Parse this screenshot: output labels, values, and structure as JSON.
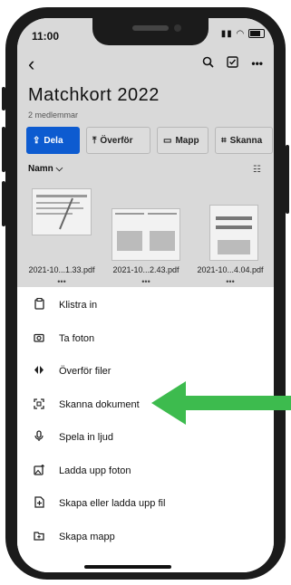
{
  "status": {
    "time": "11:00"
  },
  "folder": {
    "title": "Matchkort 2022",
    "members": "2 medlemmar"
  },
  "actions": [
    {
      "label": "Dela",
      "icon": "share-icon"
    },
    {
      "label": "Överför",
      "icon": "upload-icon"
    },
    {
      "label": "Mapp",
      "icon": "folder-icon"
    },
    {
      "label": "Skanna",
      "icon": "scan-icon"
    }
  ],
  "sort": {
    "label": "Namn"
  },
  "files": [
    {
      "name": "2021-10...1.33.pdf"
    },
    {
      "name": "2021-10...2.43.pdf"
    },
    {
      "name": "2021-10...4.04.pdf"
    }
  ],
  "menu": [
    {
      "label": "Klistra in",
      "icon": "paste-icon"
    },
    {
      "label": "Ta foton",
      "icon": "camera-icon"
    },
    {
      "label": "Överför filer",
      "icon": "transfer-icon"
    },
    {
      "label": "Skanna dokument",
      "icon": "scan-document-icon"
    },
    {
      "label": "Spela in ljud",
      "icon": "microphone-icon"
    },
    {
      "label": "Ladda upp foton",
      "icon": "upload-photo-icon"
    },
    {
      "label": "Skapa eller ladda upp fil",
      "icon": "create-file-icon"
    },
    {
      "label": "Skapa mapp",
      "icon": "create-folder-icon"
    }
  ],
  "colors": {
    "accent": "#0d5bd0",
    "arrow": "#3dbb4e"
  }
}
